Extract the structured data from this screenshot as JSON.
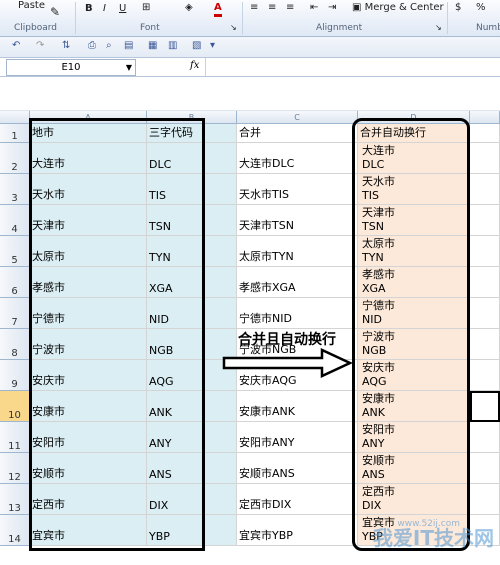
{
  "ribbon": {
    "paste_label": "Paste",
    "clipboard_label": "Clipboard",
    "font_label": "Font",
    "alignment_label": "Alignment",
    "merge_label": "Merge & Center",
    "number_label": "Numb",
    "bold": "B",
    "italic": "I",
    "underline": "U",
    "font_color": "A",
    "dollar": "$",
    "percent": "%"
  },
  "formula_bar": {
    "name_box": "E10",
    "fx_label": "fx"
  },
  "columns": [
    "A",
    "B",
    "C",
    "D"
  ],
  "annotation": "合并且自动换行",
  "watermark": "我爱IT技术网",
  "rows": [
    {
      "n": "1",
      "a": "地市",
      "b": "三字代码",
      "c": "合并",
      "d": "合并自动换行"
    },
    {
      "n": "2",
      "a": "大连市",
      "b": "DLC",
      "c": "大连市DLC",
      "d": "大连市\nDLC"
    },
    {
      "n": "3",
      "a": "天水市",
      "b": "TIS",
      "c": "天水市TIS",
      "d": "天水市\nTIS"
    },
    {
      "n": "4",
      "a": "天津市",
      "b": "TSN",
      "c": "天津市TSN",
      "d": "天津市\nTSN"
    },
    {
      "n": "5",
      "a": "太原市",
      "b": "TYN",
      "c": "太原市TYN",
      "d": "太原市\nTYN"
    },
    {
      "n": "6",
      "a": "孝感市",
      "b": "XGA",
      "c": "孝感市XGA",
      "d": "孝感市\nXGA"
    },
    {
      "n": "7",
      "a": "宁德市",
      "b": "NID",
      "c": "宁德市NID",
      "d": "宁德市\nNID"
    },
    {
      "n": "8",
      "a": "宁波市",
      "b": "NGB",
      "c": "宁波市NGB",
      "d": "宁波市\nNGB"
    },
    {
      "n": "9",
      "a": "安庆市",
      "b": "AQG",
      "c": "安庆市AQG",
      "d": "安庆市\nAQG"
    },
    {
      "n": "10",
      "a": "安康市",
      "b": "ANK",
      "c": "安康市ANK",
      "d": "安康市\nANK"
    },
    {
      "n": "11",
      "a": "安阳市",
      "b": "ANY",
      "c": "安阳市ANY",
      "d": "安阳市\nANY"
    },
    {
      "n": "12",
      "a": "安顺市",
      "b": "ANS",
      "c": "安顺市ANS",
      "d": "安顺市\nANS"
    },
    {
      "n": "13",
      "a": "定西市",
      "b": "DIX",
      "c": "定西市DIX",
      "d": "定西市\nDIX"
    },
    {
      "n": "14",
      "a": "宜宾市",
      "b": "YBP",
      "c": "宜宾市YBP",
      "d": "宜宾市\nYBP"
    }
  ]
}
